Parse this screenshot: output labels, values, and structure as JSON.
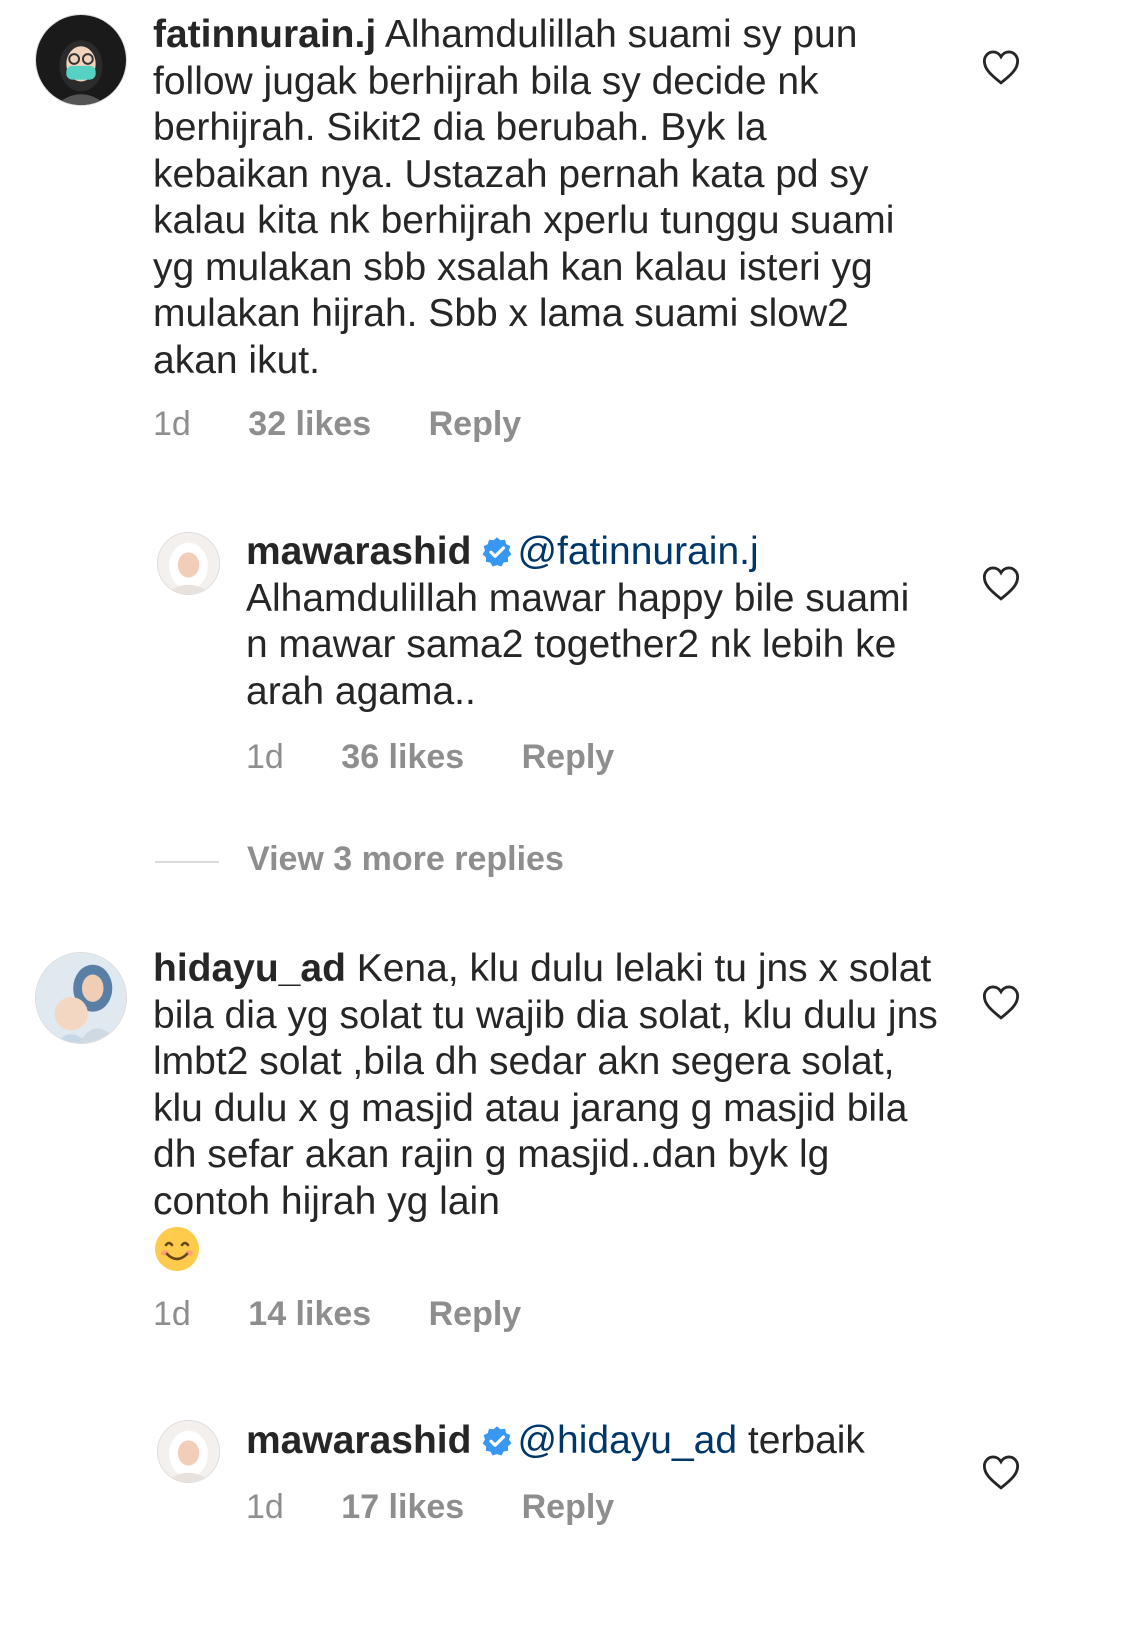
{
  "comments": [
    {
      "username": "fatinnurain.j",
      "text": "Alhamdulillah suami sy pun follow jugak berhijrah bila sy decide nk berhijrah. Sikit2 dia berubah. Byk la kebaikan nya. Ustazah pernah kata pd sy kalau kita nk berhijrah xperlu tunggu suami yg mulakan sbb xsalah kan kalau isteri yg mulakan hijrah. Sbb x lama suami slow2 akan ikut.",
      "time": "1d",
      "likes": "32 likes",
      "reply": "Reply"
    },
    {
      "username": "mawarashid",
      "mention": "@fatinnurain.j",
      "text": "Alhamdulillah mawar happy bile suami n mawar sama2 together2 nk lebih ke arah agama..",
      "time": "1d",
      "likes": "36 likes",
      "reply": "Reply"
    },
    {
      "username": "hidayu_ad",
      "text": "Kena, klu dulu lelaki tu jns x solat bila dia yg solat tu wajib dia solat, klu dulu jns lmbt2 solat ,bila dh sedar akn segera solat, klu dulu x g masjid atau jarang g masjid bila dh sefar akan rajin g masjid..dan byk lg contoh hijrah yg lain",
      "emoji": "smiling-face-icon",
      "time": "1d",
      "likes": "14 likes",
      "reply": "Reply"
    },
    {
      "username": "mawarashid",
      "mention": "@hidayu_ad",
      "text": "terbaik",
      "time": "1d",
      "likes": "17 likes",
      "reply": "Reply"
    }
  ],
  "view_more": "View 3 more replies",
  "colors": {
    "text": "#262626",
    "meta": "#8e8e8e",
    "mention": "#00376b",
    "verified": "#3897f0"
  }
}
